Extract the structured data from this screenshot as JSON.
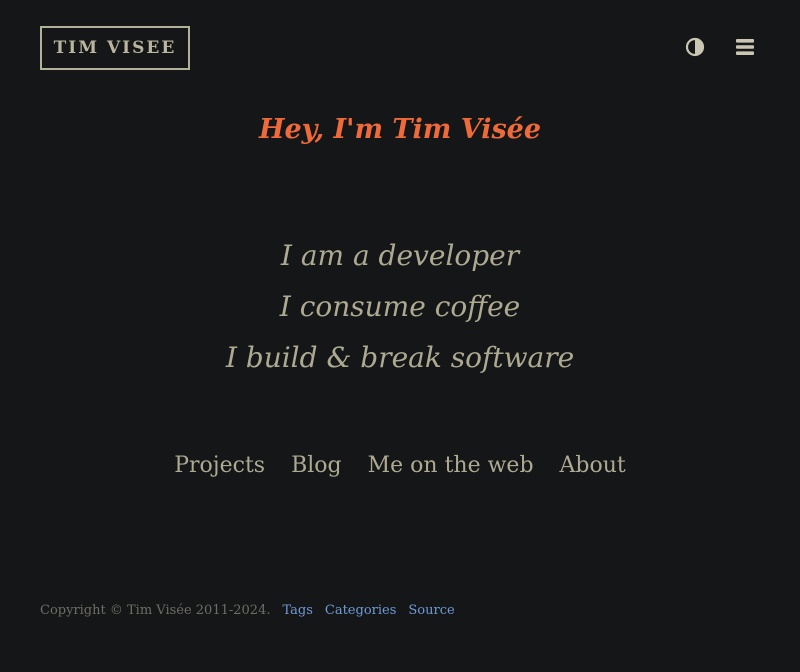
{
  "header": {
    "logo_text": "TIM VISEE",
    "icons": [
      "theme-toggle-icon",
      "menu-icon"
    ]
  },
  "hero": {
    "title": "Hey, I'm Tim Visée",
    "taglines": [
      "I am a developer",
      "I consume coffee",
      "I build & break software"
    ]
  },
  "nav": {
    "items": [
      "Projects",
      "Blog",
      "Me on the web",
      "About"
    ]
  },
  "footer": {
    "copyright": "Copyright © Tim Visée 2011-2024.",
    "links": [
      "Tags",
      "Categories",
      "Source"
    ]
  },
  "colors": {
    "background": "#141617",
    "accent": "#ef6a3b",
    "text": "#aeaa91",
    "link": "#6f9ad6"
  }
}
